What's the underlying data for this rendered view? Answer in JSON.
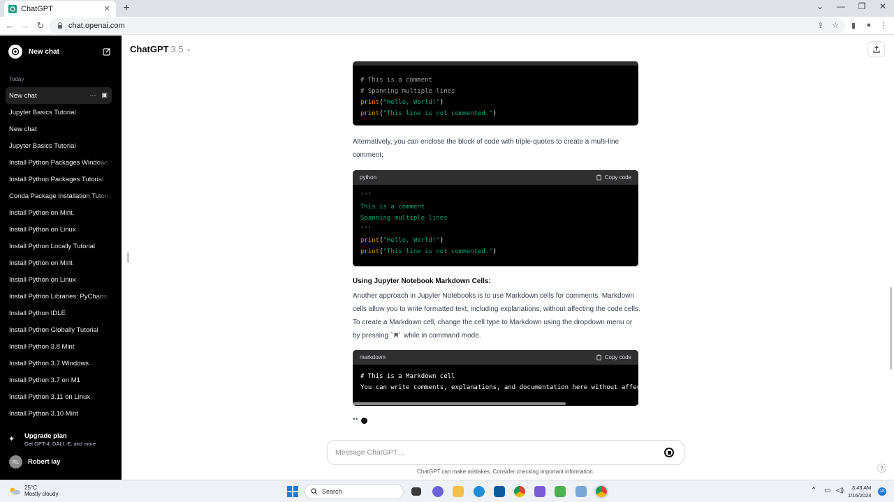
{
  "browser": {
    "tab_title": "ChatGPT",
    "tab_close": "✕",
    "new_tab": "+",
    "url": "chat.openai.com"
  },
  "sidebar": {
    "new_chat": "New chat",
    "section_today": "Today",
    "history": [
      {
        "label": "New chat",
        "active": true
      },
      {
        "label": "Jupyter Basics Tutorial"
      },
      {
        "label": "New chat"
      },
      {
        "label": "Jupyter Basics Tutorial"
      },
      {
        "label": "Install Python Packages Windows"
      },
      {
        "label": "Install Python Packages Tutorial"
      },
      {
        "label": "Conda Package Installation Tutorial"
      },
      {
        "label": "Install Python on Mint."
      },
      {
        "label": "Install Python on Linux"
      },
      {
        "label": "Install Python Locally Tutorial"
      },
      {
        "label": "Install Python on Mint"
      },
      {
        "label": "Install Python on Linux"
      },
      {
        "label": "Install Python Libraries: PyCharm"
      },
      {
        "label": "Install Python IDLE"
      },
      {
        "label": "Install Python Globally Tutorial"
      },
      {
        "label": "Install Python 3.8 Mint"
      },
      {
        "label": "Install Python 3.7 Windows"
      },
      {
        "label": "Install Python 3.7 on M1"
      },
      {
        "label": "Install Python 3.11 on Linux"
      },
      {
        "label": "Install Python 3.10 Mint"
      }
    ],
    "active_more": "···",
    "upgrade_title": "Upgrade plan",
    "upgrade_sub": "Get GPT-4, DALL·E, and more",
    "user_initials": "RL",
    "user_name": "Robert lay"
  },
  "header": {
    "model": "ChatGPT",
    "version": "3.5",
    "chevron": "⌄"
  },
  "content": {
    "code1_lines": [
      [
        {
          "t": "# This is a comment",
          "c": "c-comment"
        }
      ],
      [
        {
          "t": "# Spanning multiple lines",
          "c": "c-comment"
        }
      ],
      [
        {
          "t": "print",
          "c": "c-fn"
        },
        {
          "t": "(",
          "c": "c-plain"
        },
        {
          "t": "\"Hello, World!\"",
          "c": "c-str"
        },
        {
          "t": ")",
          "c": "c-plain"
        }
      ],
      [
        {
          "t": "print",
          "c": "c-fn"
        },
        {
          "t": "(",
          "c": "c-plain"
        },
        {
          "t": "\"This line is not commented.\"",
          "c": "c-str"
        },
        {
          "t": ")",
          "c": "c-plain"
        }
      ]
    ],
    "para1": "Alternatively, you can enclose the block of code with triple-quotes to create a multi-line comment:",
    "code2_lang": "python",
    "copy_label": "Copy code",
    "code2_lines": [
      [
        {
          "t": "'''",
          "c": "c-quote"
        }
      ],
      [
        {
          "t": "This is a comment",
          "c": "c-doc"
        }
      ],
      [
        {
          "t": "Spanning multiple lines",
          "c": "c-doc"
        }
      ],
      [
        {
          "t": "'''",
          "c": "c-quote"
        }
      ],
      [
        {
          "t": "print",
          "c": "c-fn"
        },
        {
          "t": "(",
          "c": "c-plain"
        },
        {
          "t": "\"Hello, World!\"",
          "c": "c-str"
        },
        {
          "t": ")",
          "c": "c-plain"
        }
      ],
      [
        {
          "t": "print",
          "c": "c-fn"
        },
        {
          "t": "(",
          "c": "c-plain"
        },
        {
          "t": "\"This line is not commented.\"",
          "c": "c-str"
        },
        {
          "t": ")",
          "c": "c-plain"
        }
      ]
    ],
    "heading": "Using Jupyter Notebook Markdown Cells:",
    "para2_before": "Another approach in Jupyter Notebooks is to use Markdown cells for comments. Markdown cells allow you to write formatted text, including explanations, without affecting the code cells. To create a Markdown cell, change the cell type to Markdown using the dropdown menu or by pressing ",
    "para2_code": "`M`",
    "para2_after": " while in command mode.",
    "code3_lang": "markdown",
    "code3_lines": [
      [
        {
          "t": "# This is a Markdown cell",
          "c": "c-plain"
        }
      ],
      [
        {
          "t": "You can write comments, explanations, and documentation here without affecting the code.",
          "c": "c-plain"
        }
      ]
    ],
    "typing_text": "**"
  },
  "composer": {
    "placeholder": "Message ChatGPT…",
    "disclaimer": "ChatGPT can make mistakes. Consider checking important information."
  },
  "help": "?",
  "taskbar": {
    "temp": "25°C",
    "weather": "Mostly cloudy",
    "search": "Search",
    "time": "3:43 AM",
    "date": "1/16/2024",
    "notifications": "18"
  },
  "colors": {
    "sidebar_bg": "#000000",
    "code_header": "#2f2f2f",
    "code_string": "#00a67d",
    "code_function": "#e9950c",
    "code_comment": "#9a9a9a",
    "accent": "#10a37f"
  }
}
